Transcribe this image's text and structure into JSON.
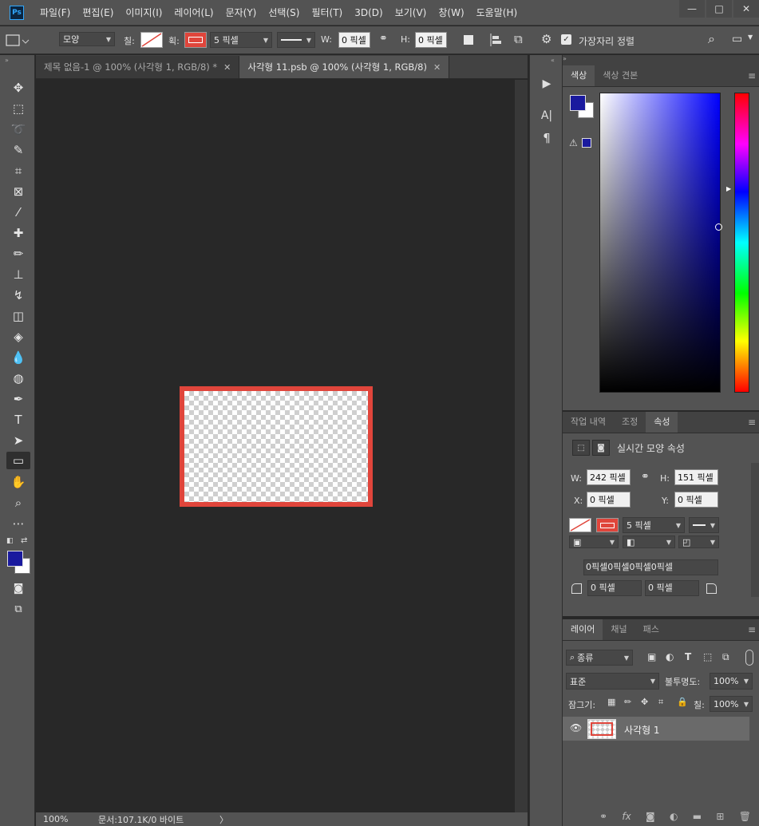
{
  "app": {
    "logo": "Ps",
    "menu": [
      "파일(F)",
      "편집(E)",
      "이미지(I)",
      "레이어(L)",
      "문자(Y)",
      "선택(S)",
      "필터(T)",
      "3D(D)",
      "보기(V)",
      "창(W)",
      "도움말(H)"
    ],
    "window_controls": {
      "minimize": "—",
      "maximize": "□",
      "close": "✕"
    }
  },
  "options": {
    "mode": "모양",
    "fill_label": "칠:",
    "stroke_label": "획:",
    "stroke_width": "5 픽셀",
    "w_label": "W:",
    "w_value": "0 픽셀",
    "h_label": "H:",
    "h_value": "0 픽셀",
    "align_edges_label": "가장자리 정렬",
    "colors": {
      "stroke": "#e0453b",
      "fill_none": "#e0453b"
    }
  },
  "tabs": [
    {
      "label": "제목 없음-1 @ 100% (사각형 1, RGB/8) *",
      "active": false
    },
    {
      "label": "사각형 11.psb @ 100% (사각형 1, RGB/8)",
      "active": true
    }
  ],
  "status": {
    "zoom": "100%",
    "doc_info": "문서:107.1K/0 바이트",
    "arrow": "〉"
  },
  "color_panel": {
    "tabs": [
      "색상",
      "색상 견본"
    ],
    "fg_color": "#1a1a9e",
    "bg_color": "#ffffff"
  },
  "props_panel": {
    "tabs": [
      "작업 내역",
      "조정",
      "속성"
    ],
    "header": "실시간 모양 속성",
    "w_label": "W:",
    "w_value": "242 픽셀",
    "h_label": "H:",
    "h_value": "151 픽셀",
    "x_label": "X:",
    "x_value": "0 픽셀",
    "y_label": "Y:",
    "y_value": "0 픽셀",
    "stroke_width": "5 픽셀",
    "corner_all": "0픽셀0픽셀0픽셀0픽셀",
    "corner_bl": "0 픽셀",
    "corner_br": "0 픽셀"
  },
  "layers_panel": {
    "tabs": [
      "레이어",
      "채널",
      "패스"
    ],
    "filter_kind": "종류",
    "blend_mode": "표준",
    "opacity_label": "불투명도:",
    "opacity_value": "100%",
    "lock_label": "잠그기:",
    "fill_label": "칠:",
    "fill_value": "100%",
    "layers": [
      {
        "name": "사각형 1",
        "visible": true
      }
    ],
    "footer_icons": [
      "link-icon",
      "fx-icon",
      "mask-icon",
      "adjustment-icon",
      "folder-icon",
      "new-layer-icon",
      "trash-icon"
    ]
  },
  "tools": [
    "move-icon",
    "marquee-icon",
    "lasso-icon",
    "quick-select-icon",
    "crop-icon",
    "frame-icon",
    "eyedropper-icon",
    "healing-icon",
    "brush-icon",
    "stamp-icon",
    "history-brush-icon",
    "eraser-icon",
    "bucket-icon",
    "blur-icon",
    "dodge-icon",
    "pen-icon",
    "type-icon",
    "path-select-icon",
    "rectangle-icon",
    "hand-icon",
    "zoom-icon",
    "more-icon"
  ]
}
